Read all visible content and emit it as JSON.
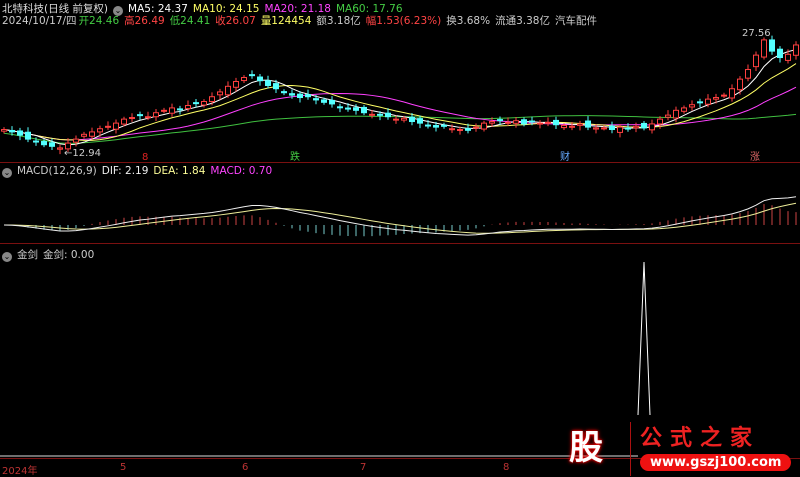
{
  "header": {
    "stock": "北特科技(日线 前复权)",
    "ma5": "MA5: 24.37",
    "ma10": "MA10: 24.15",
    "ma20": "MA20: 21.18",
    "ma60": "MA60: 17.76",
    "date": "2024/10/17/四",
    "open": "开24.46",
    "high": "高26.49",
    "low": "低24.41",
    "close": "收26.07",
    "vol": "量124454",
    "amount": "额3.18亿",
    "change": "幅1.53(6.23%)",
    "turnover": "换3.68%",
    "float": "流通3.38亿",
    "sector": "汽车配件"
  },
  "macd": {
    "title": "MACD(12,26,9)",
    "dif": "DIF: 2.19",
    "dea": "DEA: 1.84",
    "macd": "MACD: 0.70"
  },
  "jj": {
    "title": "金剑",
    "value": "金剑: 0.00"
  },
  "markers": [
    {
      "t": "8",
      "c": "#d22"
    },
    {
      "t": "跌",
      "c": "#4c4"
    },
    {
      "t": "财",
      "c": "#6af"
    },
    {
      "t": "涨",
      "c": "#d66"
    }
  ],
  "axis": [
    "2024年",
    "5",
    "6",
    "7",
    "8"
  ],
  "logo": {
    "char": "股",
    "name": "公式之家",
    "url": "www.gszj100.com"
  },
  "colors": {
    "up": "#ff4040",
    "down": "#54ffff",
    "ma5": "#ffffff",
    "ma10": "#ffff66",
    "ma20": "#ff40ff",
    "ma60": "#40c040"
  },
  "chart_data": {
    "type": "candlestick",
    "title": "北特科技 日线",
    "max_label": "27.56",
    "min_label": "12.94",
    "closes": [
      15.5,
      15.2,
      14.8,
      14.3,
      14.0,
      13.6,
      13.4,
      13.2,
      13.8,
      14.3,
      14.9,
      15.2,
      15.6,
      15.9,
      16.3,
      16.8,
      17.0,
      17.3,
      17.1,
      17.6,
      17.9,
      18.2,
      18.0,
      18.5,
      18.8,
      19.0,
      19.6,
      20.2,
      20.9,
      21.5,
      22.0,
      22.3,
      21.6,
      21.0,
      20.6,
      20.1,
      19.8,
      19.5,
      19.6,
      19.2,
      18.9,
      18.7,
      18.3,
      18.1,
      17.9,
      17.6,
      17.4,
      17.3,
      17.1,
      16.8,
      16.9,
      16.5,
      16.3,
      16.0,
      15.8,
      15.9,
      15.6,
      15.5,
      15.4,
      15.8,
      16.3,
      16.5,
      16.7,
      16.4,
      16.6,
      16.2,
      16.5,
      16.3,
      16.4,
      16.1,
      16.0,
      15.9,
      16.2,
      15.8,
      15.7,
      15.7,
      15.5,
      15.8,
      15.6,
      15.9,
      15.7,
      16.2,
      16.8,
      17.3,
      17.9,
      18.2,
      18.6,
      18.9,
      19.3,
      19.5,
      19.8,
      20.6,
      21.8,
      23.0,
      24.8,
      26.7,
      25.3,
      24.5,
      24.9,
      26.07
    ],
    "ylim": [
      12.5,
      28.5
    ],
    "jj_spike_index": 80
  }
}
